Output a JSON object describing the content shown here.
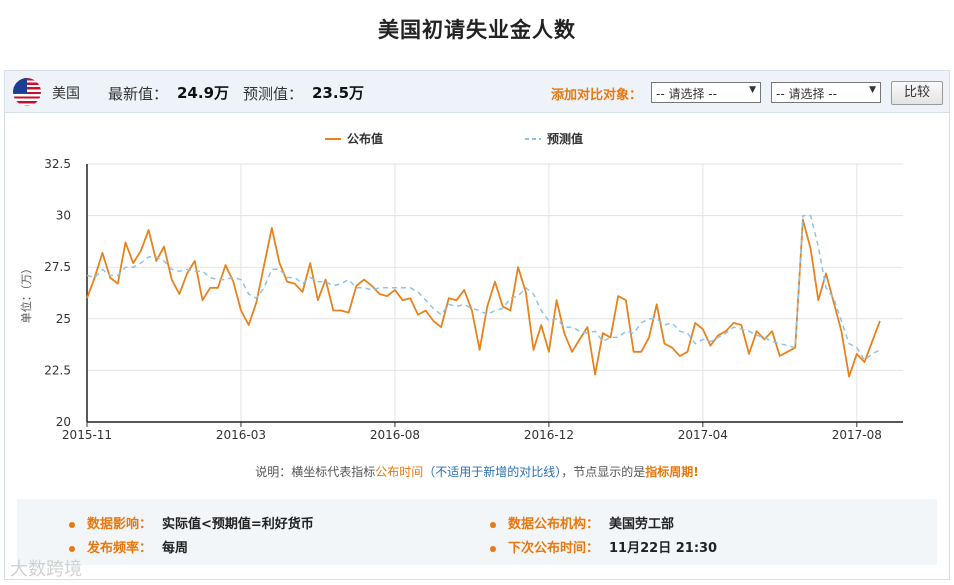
{
  "page_title": "美国初请失业金人数",
  "header": {
    "flag_icon": "us-flag-icon",
    "country": "美国",
    "latest_label": "最新值：",
    "latest_value": "24.9万",
    "forecast_label": "预测值：",
    "forecast_value": "23.5万",
    "compare_label": "添加对比对象：",
    "select1": "-- 请选择 --",
    "select2": "-- 请选择 --",
    "compare_button": "比较"
  },
  "note": {
    "p1": "说明：横坐标代表指标",
    "p2": "公布时间",
    "p3": "（不适用于新增的对比线）",
    "p4": "，节点显示的是",
    "p5": "指标周期!"
  },
  "info": {
    "impact_label": "数据影响：",
    "impact_value": "实际值<预期值=利好货币",
    "agency_label": "数据公布机构：",
    "agency_value": "美国劳工部",
    "freq_label": "发布频率：",
    "freq_value": "每周",
    "next_label": "下次公布时间：",
    "next_value": "11月22日 21:30"
  },
  "watermark": "大数跨境",
  "colors": {
    "actual": "#e8821c",
    "forecast": "#8ec3ea",
    "accent": "#e8790f"
  },
  "chart_data": {
    "type": "line",
    "ylabel": "单位：（万）",
    "ylim": [
      20,
      32.5
    ],
    "yticks": [
      "20",
      "22.5",
      "25",
      "27.5",
      "30",
      "32.5"
    ],
    "xticks": [
      "2015-11",
      "2016-03",
      "2016-08",
      "2016-12",
      "2017-04",
      "2017-08"
    ],
    "legend_position": "top-center",
    "grid": true,
    "x_range_weeks": 106,
    "xtick_weeks": [
      0,
      20,
      40,
      60,
      80,
      100
    ],
    "series": [
      {
        "name": "公布值",
        "color": "#e8821c",
        "dash": false,
        "values": [
          26.0,
          27.0,
          28.2,
          27.0,
          26.7,
          28.7,
          27.7,
          28.3,
          29.3,
          27.8,
          28.5,
          26.9,
          26.2,
          27.2,
          27.8,
          25.9,
          26.5,
          26.5,
          27.6,
          26.8,
          25.4,
          24.7,
          25.8,
          27.6,
          29.4,
          27.7,
          26.8,
          26.7,
          26.3,
          27.7,
          25.9,
          26.9,
          25.4,
          25.4,
          25.3,
          26.6,
          26.9,
          26.6,
          26.2,
          26.1,
          26.4,
          25.9,
          26.0,
          25.2,
          25.4,
          24.9,
          24.6,
          26.0,
          25.9,
          26.4,
          25.4,
          23.5,
          25.6,
          26.8,
          25.6,
          25.4,
          27.5,
          26.3,
          23.5,
          24.7,
          23.4,
          25.9,
          24.3,
          23.4,
          24.0,
          24.6,
          22.3,
          24.3,
          24.1,
          26.1,
          25.9,
          23.4,
          23.4,
          24.1,
          25.7,
          23.8,
          23.6,
          23.2,
          23.4,
          24.8,
          24.5,
          23.7,
          24.2,
          24.4,
          24.8,
          24.7,
          23.3,
          24.4,
          24.0,
          24.4,
          23.2,
          23.4,
          23.6,
          29.8,
          28.4,
          25.9,
          27.2,
          25.8,
          24.4,
          22.2,
          23.3,
          22.9,
          23.9,
          24.9
        ]
      },
      {
        "name": "预测值",
        "color": "#8ec3ea",
        "dash": true,
        "values": [
          27.1,
          27.0,
          27.4,
          27.1,
          27.1,
          27.5,
          27.5,
          27.7,
          28.0,
          28.0,
          27.8,
          27.4,
          27.3,
          27.4,
          27.3,
          27.3,
          27.0,
          26.9,
          26.9,
          27.0,
          26.9,
          26.2,
          26.0,
          26.5,
          27.4,
          27.4,
          27.0,
          27.0,
          26.7,
          27.0,
          26.8,
          26.8,
          26.6,
          26.7,
          26.9,
          26.5,
          26.5,
          26.4,
          26.5,
          26.5,
          26.5,
          26.5,
          26.5,
          26.3,
          25.9,
          25.5,
          25.2,
          25.7,
          25.6,
          25.7,
          25.5,
          25.4,
          25.2,
          25.4,
          25.5,
          26.0,
          26.1,
          26.5,
          26.2,
          25.4,
          24.9,
          25.0,
          24.6,
          24.6,
          24.4,
          24.3,
          24.4,
          23.9,
          24.1,
          24.1,
          24.4,
          24.3,
          24.8,
          25.0,
          25.0,
          24.7,
          24.8,
          24.4,
          24.3,
          23.8,
          24.0,
          23.9,
          24.1,
          24.3,
          24.6,
          24.5,
          24.4,
          24.2,
          24.1,
          23.9,
          23.8,
          23.7,
          23.6,
          30.0,
          30.0,
          28.5,
          26.5,
          26.0,
          24.9,
          23.8,
          23.6,
          23.0,
          23.3,
          23.5
        ]
      }
    ]
  }
}
